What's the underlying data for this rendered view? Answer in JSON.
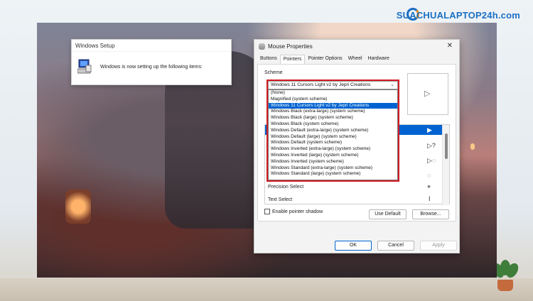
{
  "brand": {
    "text": "SUACHUALAPTOP24h.com"
  },
  "setup_dialog": {
    "title": "Windows Setup",
    "message": "Windows is now setting up the following items:"
  },
  "mouse_dialog": {
    "title": "Mouse Properties",
    "close_glyph": "✕",
    "tabs": [
      "Buttons",
      "Pointers",
      "Pointer Options",
      "Wheel",
      "Hardware"
    ],
    "active_tab": "Pointers",
    "scheme_label": "Scheme",
    "scheme_selected": "Windows 11 Cursors Light v2 by Jepri Creations",
    "scheme_options": [
      "(None)",
      "Magnified (system scheme)",
      "Windows 11 Cursors Light v2 by Jepri Creations",
      "Windows Black (extra-large) (system scheme)",
      "Windows Black (large) (system scheme)",
      "Windows Black (system scheme)",
      "Windows Default (extra-large) (system scheme)",
      "Windows Default (large) (system scheme)",
      "Windows Default (system scheme)",
      "Windows Inverted (extra-large) (system scheme)",
      "Windows Inverted (large) (system scheme)",
      "Windows Inverted (system scheme)",
      "Windows Standard (extra-large) (system scheme)",
      "Windows Standard (large) (system scheme)"
    ],
    "cursor_rows": [
      {
        "label": "Precision Select",
        "icon": "crosshair-icon"
      },
      {
        "label": "Text Select",
        "icon": "text-select-icon"
      }
    ],
    "enable_shadow_label": "Enable pointer shadow",
    "use_default_label": "Use Default",
    "browse_label": "Browse...",
    "ok_label": "OK",
    "cancel_label": "Cancel",
    "apply_label": "Apply"
  },
  "colors": {
    "accent": "#0063d1",
    "highlight_box": "#d31b24"
  }
}
